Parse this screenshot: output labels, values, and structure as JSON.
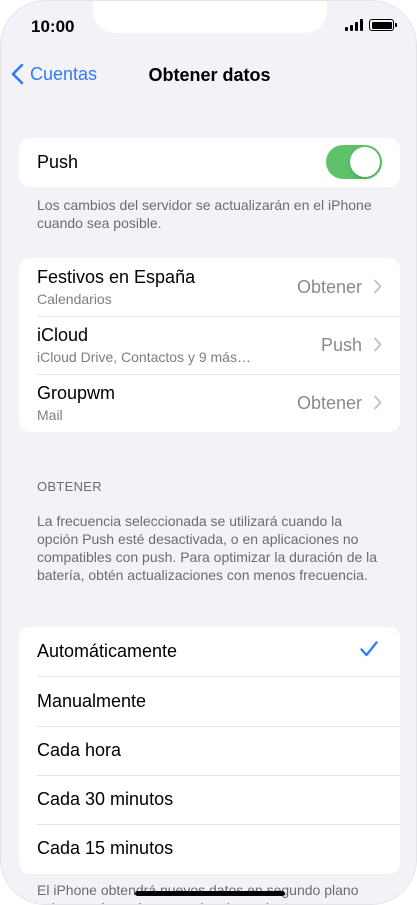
{
  "status_bar": {
    "time": "10:00"
  },
  "nav": {
    "back_label": "Cuentas",
    "title": "Obtener datos"
  },
  "push": {
    "label": "Push",
    "enabled": true,
    "footnote": "Los cambios del servidor se actualizarán en el iPhone cuando sea posible."
  },
  "accounts": [
    {
      "name": "Festivos en España",
      "detail": "Calendarios",
      "value": "Obtener"
    },
    {
      "name": "iCloud",
      "detail": "iCloud Drive, Contactos y 9 más…",
      "value": "Push"
    },
    {
      "name": "Groupwm",
      "detail": "Mail",
      "value": "Obtener"
    }
  ],
  "fetch": {
    "header": "OBTENER",
    "description": "La frecuencia seleccionada se utilizará cuando la opción Push esté desactivada, o en aplicaciones no compatibles con push. Para optimizar la duración de la batería, obtén actualizaciones con menos frecuencia.",
    "options": [
      {
        "label": "Automáticamente",
        "selected": true
      },
      {
        "label": "Manualmente",
        "selected": false
      },
      {
        "label": "Cada hora",
        "selected": false
      },
      {
        "label": "Cada 30 minutos",
        "selected": false
      },
      {
        "label": "Cada 15 minutos",
        "selected": false
      }
    ],
    "bottom_note": "El iPhone obtendrá nuevos datos en segundo plano solo cuando esté conectado a la corriente y a una"
  },
  "colors": {
    "accent": "#2f7cf6",
    "toggle_on": "#5ec26a",
    "background": "#f2f2f7"
  }
}
